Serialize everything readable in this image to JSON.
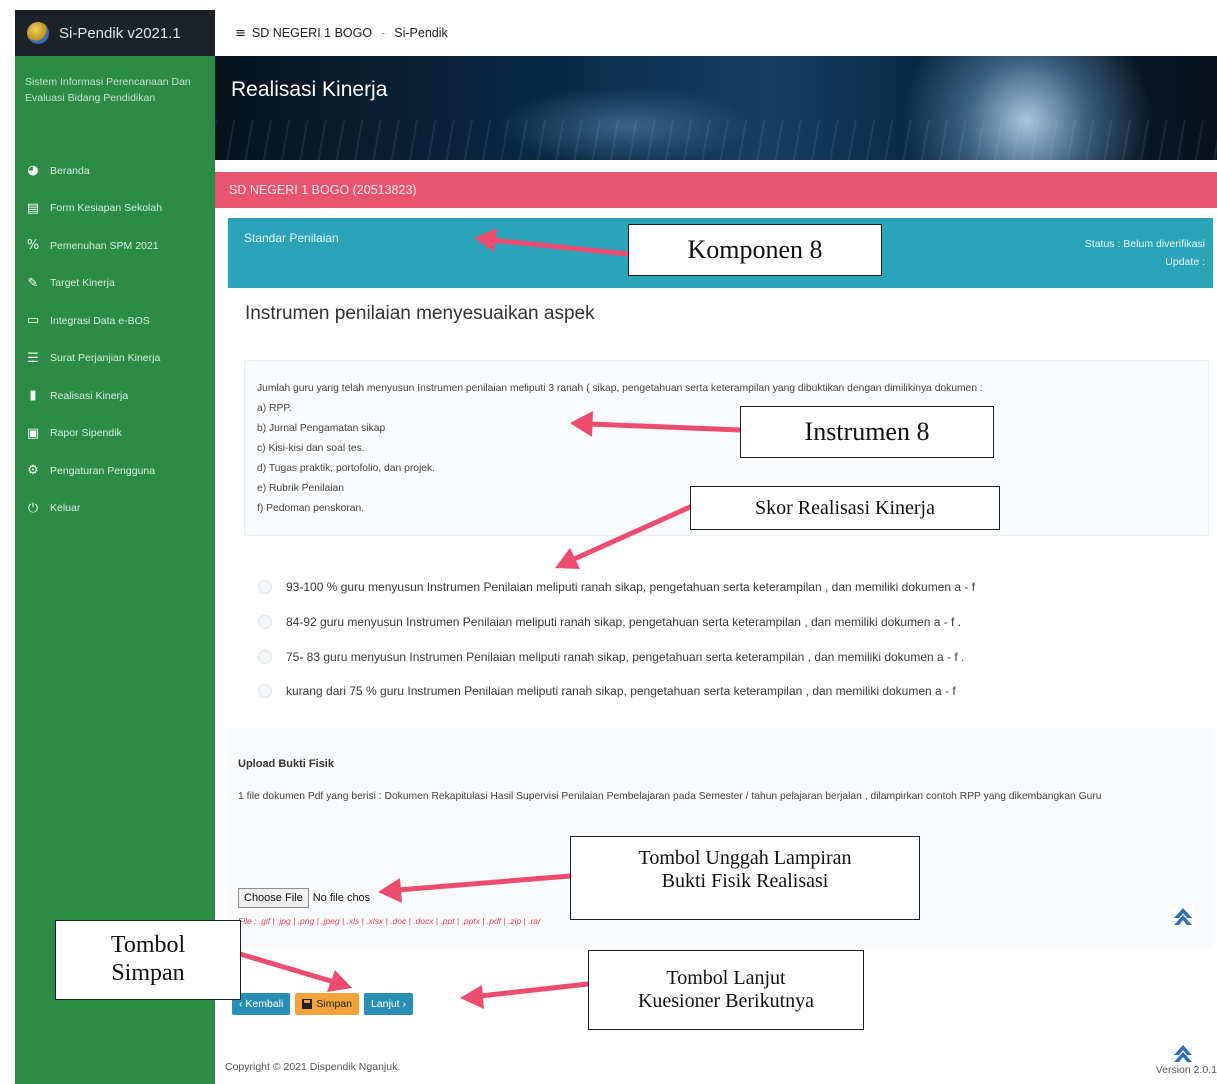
{
  "sidebar": {
    "app_title": "Si-Pendik v2021.1",
    "subtitle": "Sistem Informasi Perencanaan Dan Evaluasi Bidang Pendidikan",
    "items": [
      {
        "label": "Beranda",
        "icon": "dashboard-icon",
        "glyph": "◕"
      },
      {
        "label": "Form Kesiapan Sekolah",
        "icon": "document-icon",
        "glyph": "▤"
      },
      {
        "label": "Pemenuhan SPM 2021",
        "icon": "percent-icon",
        "glyph": "%"
      },
      {
        "label": "Target Kinerja",
        "icon": "edit-icon",
        "glyph": "✎"
      },
      {
        "label": "Integrasi Data e-BOS",
        "icon": "monitor-icon",
        "glyph": "▭"
      },
      {
        "label": "Surat Perjanjian Kinerja",
        "icon": "list-icon",
        "glyph": "☰"
      },
      {
        "label": "Realisasi Kinerja",
        "icon": "file-icon",
        "glyph": "▮"
      },
      {
        "label": "Rapor Sipendik",
        "icon": "floppy-icon",
        "glyph": "▣"
      },
      {
        "label": "Pengaturan Pengguna",
        "icon": "gears-icon",
        "glyph": "⚙"
      },
      {
        "label": "Keluar",
        "icon": "power-icon",
        "glyph": "⏻"
      }
    ]
  },
  "topbar": {
    "menu_icon": "≡",
    "school": "SD NEGERI 1 BOGO",
    "separator": "-",
    "app": "Si-Pendik"
  },
  "banner": {
    "title": "Realisasi Kinerja"
  },
  "school_bar": {
    "label": "SD NEGERI 1 BOGO (20513823)"
  },
  "standard": {
    "title": "Standar Penilaian",
    "status": "Status : Belum diverifikasi",
    "update": "Update :"
  },
  "question": {
    "title": "Instrumen penilaian menyesuaikan aspek",
    "lead": "Jumlah guru yang telah menyusun Instrumen penilaian meliputi 3 ranah ( sikap, pengetahuan serta keterampilan yang dibuktikan dengan dimilikinya dokumen :",
    "items": [
      "a) RPP.",
      "b) Jurnal Pengamatan sikap",
      "c) Kisi-kisi dan soal tes.",
      "d) Tugas praktik, portofolio, dan projek.",
      "e) Rubrik Penilaian",
      "f) Pedoman penskoran."
    ],
    "options": [
      "93-100 % guru menyusun Instrumen Penilaian meliputi ranah sikap, pengetahuan serta keterampilan , dan memiliki dokumen a - f",
      "84-92 guru menyusun Instrumen Penilaian meliputi ranah sikap, pengetahuan serta keterampilan , dan memiliki dokumen a - f .",
      "75- 83 guru menyusun Instrumen Penilaian meliputi ranah sikap, pengetahuan serta keterampilan , dan memiliki dokumen a - f .",
      "kurang dari 75 % guru Instrumen Penilaian meliputi ranah sikap, pengetahuan serta keterampilan , dan memiliki dokumen a - f"
    ]
  },
  "upload": {
    "title": "Upload Bukti Fisik",
    "description": "1 file dokumen Pdf yang berisi : Dokumen Rekapitulasi Hasil Supervisi Penilaian Pembelajaran pada Semester / tahun pelajaran berjalan , dilampirkan contoh RPP yang dikembangkan Guru",
    "choose_label": "Choose File",
    "file_status": "No file chos",
    "file_types": "File : .gif | .jpg | .png | .jpeg | .xls | .xlsx | .doc | .docx | .ppt | .pptx | .pdf | .zip | .rar"
  },
  "buttons": {
    "back": "‹ Kembali",
    "save": "Simpan",
    "next": "Lanjut ›"
  },
  "footer": {
    "copyright": "Copyright © 2021 Dispendik Nganjuk.",
    "version": "Version 2.0.1"
  },
  "annotations": {
    "komponen": "Komponen 8",
    "instrumen": "Instrumen 8",
    "skor": "Skor Realisasi Kinerja",
    "unggah_line1": "Tombol Unggah Lampiran",
    "unggah_line2": "Bukti Fisik Realisasi",
    "simpan_line1": "Tombol",
    "simpan_line2": "Simpan",
    "lanjut_line1": "Tombol Lanjut",
    "lanjut_line2": "Kuesioner Berikutnya"
  },
  "colors": {
    "sidebar": "#2c8c45",
    "school_bar": "#e9556f",
    "standard_bar": "#2ba3b8",
    "save_button": "#f0a33a",
    "nav_buttons": "#2a8fb5",
    "annotation_arrow": "#ee4c6f"
  }
}
